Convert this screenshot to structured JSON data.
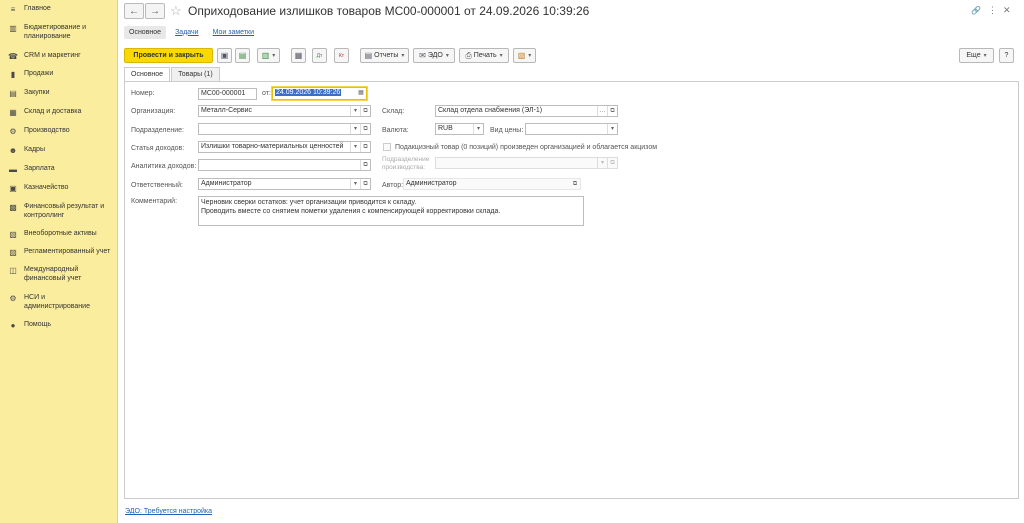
{
  "sidebar": {
    "items": [
      {
        "label": "Главное",
        "icon": "≡"
      },
      {
        "label": "Бюджетирование и планирование",
        "icon": "▥"
      },
      {
        "label": "CRM и маркетинг",
        "icon": "☎"
      },
      {
        "label": "Продажи",
        "icon": "▮"
      },
      {
        "label": "Закупки",
        "icon": "▤"
      },
      {
        "label": "Склад и доставка",
        "icon": "▦"
      },
      {
        "label": "Производство",
        "icon": "⚙"
      },
      {
        "label": "Кадры",
        "icon": "☻"
      },
      {
        "label": "Зарплата",
        "icon": "▬"
      },
      {
        "label": "Казначейство",
        "icon": "▣"
      },
      {
        "label": "Финансовый результат и контроллинг",
        "icon": "▩"
      },
      {
        "label": "Внеоборотные активы",
        "icon": "▧"
      },
      {
        "label": "Регламентированный учет",
        "icon": "▨"
      },
      {
        "label": "Международный финансовый учет",
        "icon": "◫"
      },
      {
        "label": "НСИ и администрирование",
        "icon": "⚙"
      },
      {
        "label": "Помощь",
        "icon": "●"
      }
    ]
  },
  "window": {
    "title": "Оприходование излишков товаров МС00-000001 от 24.09.2026 10:39:26",
    "back": "←",
    "forward": "→",
    "star": "☆",
    "link_icon": "🔗",
    "menu_icon": "⋮",
    "close_icon": "✕"
  },
  "sections": {
    "main": "Основное",
    "tasks": "Задачи",
    "notes": "Мои заметки"
  },
  "toolbar": {
    "post_close": "Провести и закрыть",
    "save_icon": "▣",
    "dt_icon": "Дт",
    "kt_icon": "Кт",
    "reports": "Отчеты",
    "edo": "ЭДО",
    "print": "Печать",
    "more": "Еще",
    "help": "?"
  },
  "form_tabs": {
    "main": "Основное",
    "goods": "Товары (1)"
  },
  "form": {
    "number_label": "Номер:",
    "number_value": "МС00-000001",
    "date_label": "от:",
    "date_value": "24.09.2026 10:39:26",
    "org_label": "Организация:",
    "org_value": "Металл-Сервис",
    "warehouse_label": "Склад:",
    "warehouse_value": "Склад отдела снабжения (ЭЛ-1)",
    "dept_label": "Подразделение:",
    "dept_value": "",
    "currency_label": "Валюта:",
    "currency_value": "RUB",
    "price_type_label": "Вид цены:",
    "price_type_value": "",
    "income_item_label": "Статья доходов:",
    "income_item_value": "Излишки товарно-материальных ценностей",
    "excise_label": "Подакцизный товар (0 позиций) произведен организацией и облагается акцизом",
    "income_analytics_label": "Аналитика доходов:",
    "income_analytics_value": "",
    "prod_dept_label": "Подразделение производства:",
    "prod_dept_value": "",
    "responsible_label": "Ответственный:",
    "responsible_value": "Администратор",
    "author_label": "Автор:",
    "author_value": "Администратор",
    "comment_label": "Комментарий:",
    "comment_line1": "Черновик сверки остатков: учет организации приводится к складу.",
    "comment_line2": "Проводить вместе со снятием пометки удаления с компенсирующей корректировки склада."
  },
  "footer": {
    "edo_link": "ЭДО: Требуется настройка"
  }
}
